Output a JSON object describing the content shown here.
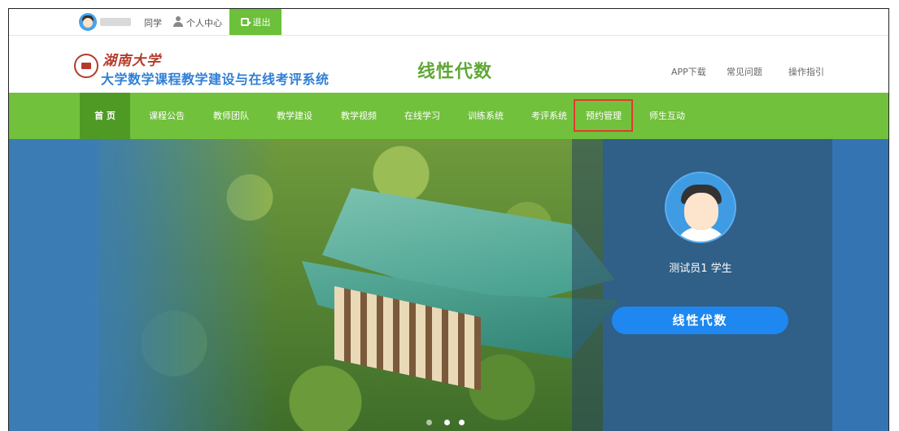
{
  "userbar": {
    "role_label": "同学",
    "profile_label": "个人中心",
    "logout_label": "退出"
  },
  "header": {
    "university": "湖南大学",
    "system_name": "大学数学课程教学建设与在线考评系统",
    "course_title": "线性代数",
    "links": [
      "APP下载",
      "常见问题",
      "操作指引"
    ]
  },
  "nav": {
    "items": [
      "首 页",
      "课程公告",
      "教师团队",
      "教学建设",
      "教学视频",
      "在线学习",
      "训练系统",
      "考评系统",
      "预约管理",
      "师生互动"
    ],
    "active": "首 页",
    "highlighted": "预约管理"
  },
  "banner": {
    "student_name": "测试员1 学生",
    "course_button": "线性代数",
    "carousel_dots": 3
  },
  "colors": {
    "nav_green": "#72c13d",
    "nav_active": "#4f9a24",
    "title_green": "#5fa836",
    "system_blue": "#2f7fd6",
    "highlight_red": "#e03a2e",
    "button_blue": "#1e88f0"
  }
}
